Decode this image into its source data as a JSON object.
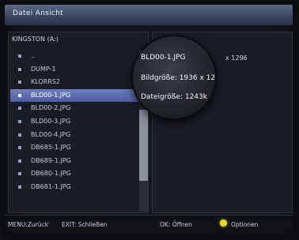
{
  "window": {
    "title": "Datei Ansicht"
  },
  "file_list": {
    "header": "KINGSTON (A:)",
    "items": [
      {
        "label": "..",
        "selected": false
      },
      {
        "label": "DUMP-1",
        "selected": false
      },
      {
        "label": "KLORRS2",
        "selected": false
      },
      {
        "label": "BLD00-1.JPG",
        "selected": true
      },
      {
        "label": "BLD00-2.JPG",
        "selected": false
      },
      {
        "label": "BLD00-3.JPG",
        "selected": false
      },
      {
        "label": "BLD00-4.JPG",
        "selected": false
      },
      {
        "label": "DB685-1.JPG",
        "selected": false
      },
      {
        "label": "DB689-1.JPG",
        "selected": false
      },
      {
        "label": "DB680-1.JPG",
        "selected": false
      },
      {
        "label": "DB681-1.JPG",
        "selected": false
      }
    ]
  },
  "info": {
    "resolution_fragment": "x 1296",
    "filename": "BLD00-1.JPG",
    "size_label": "Bildgröße: 1936 x 12",
    "filesize_label": "Dateigröße: 1243k"
  },
  "statusbar": {
    "menu_hint": "MENU:Zurück",
    "exit_hint": "EXIT: Schließen",
    "ok_hint": "OK: Öffnen",
    "options_hint": "Optionen"
  },
  "colors": {
    "selection": "#5d6eb0",
    "title_bar": "#4a556f",
    "options_dot": "#e8d430"
  }
}
